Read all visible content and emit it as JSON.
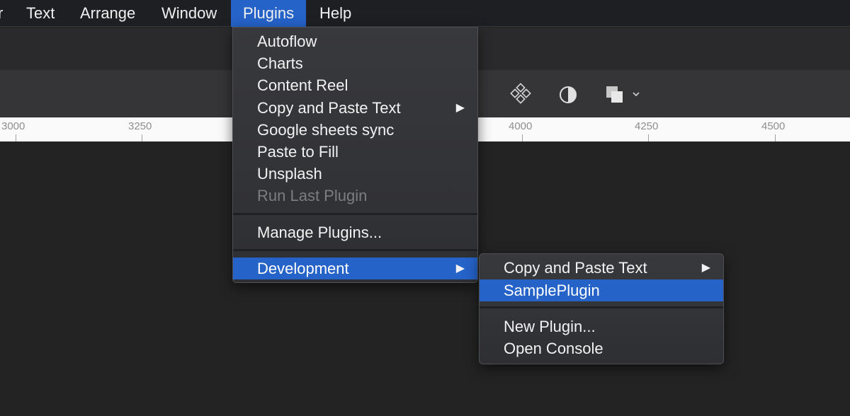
{
  "menubar": {
    "items": [
      {
        "label": "r"
      },
      {
        "label": "Text"
      },
      {
        "label": "Arrange"
      },
      {
        "label": "Window"
      },
      {
        "label": "Plugins",
        "active": true
      },
      {
        "label": "Help"
      }
    ]
  },
  "toolbar": {
    "icons": [
      "components-icon",
      "contrast-icon",
      "layers-dropdown-icon"
    ]
  },
  "ruler": {
    "labels": [
      "3000",
      "3250",
      "4000",
      "4250",
      "4500"
    ]
  },
  "plugins_menu": {
    "items": [
      {
        "label": "Autoflow"
      },
      {
        "label": "Charts"
      },
      {
        "label": "Content Reel"
      },
      {
        "label": "Copy and Paste Text",
        "submenu_arrow": "▶"
      },
      {
        "label": "Google sheets sync"
      },
      {
        "label": "Paste to Fill"
      },
      {
        "label": "Unsplash"
      },
      {
        "label": "Run Last Plugin",
        "disabled": true
      },
      {
        "label": "Manage Plugins..."
      },
      {
        "label": "Development",
        "submenu_arrow": "▶",
        "highlighted": true
      }
    ]
  },
  "development_menu": {
    "items": [
      {
        "label": "Copy and Paste Text",
        "submenu_arrow": "▶"
      },
      {
        "label": "SamplePlugin",
        "highlighted": true
      },
      {
        "label": "New Plugin..."
      },
      {
        "label": "Open Console"
      }
    ]
  },
  "colors": {
    "accent": "#2563c9",
    "menu_bg": "#333438",
    "canvas_bg": "#232323"
  }
}
